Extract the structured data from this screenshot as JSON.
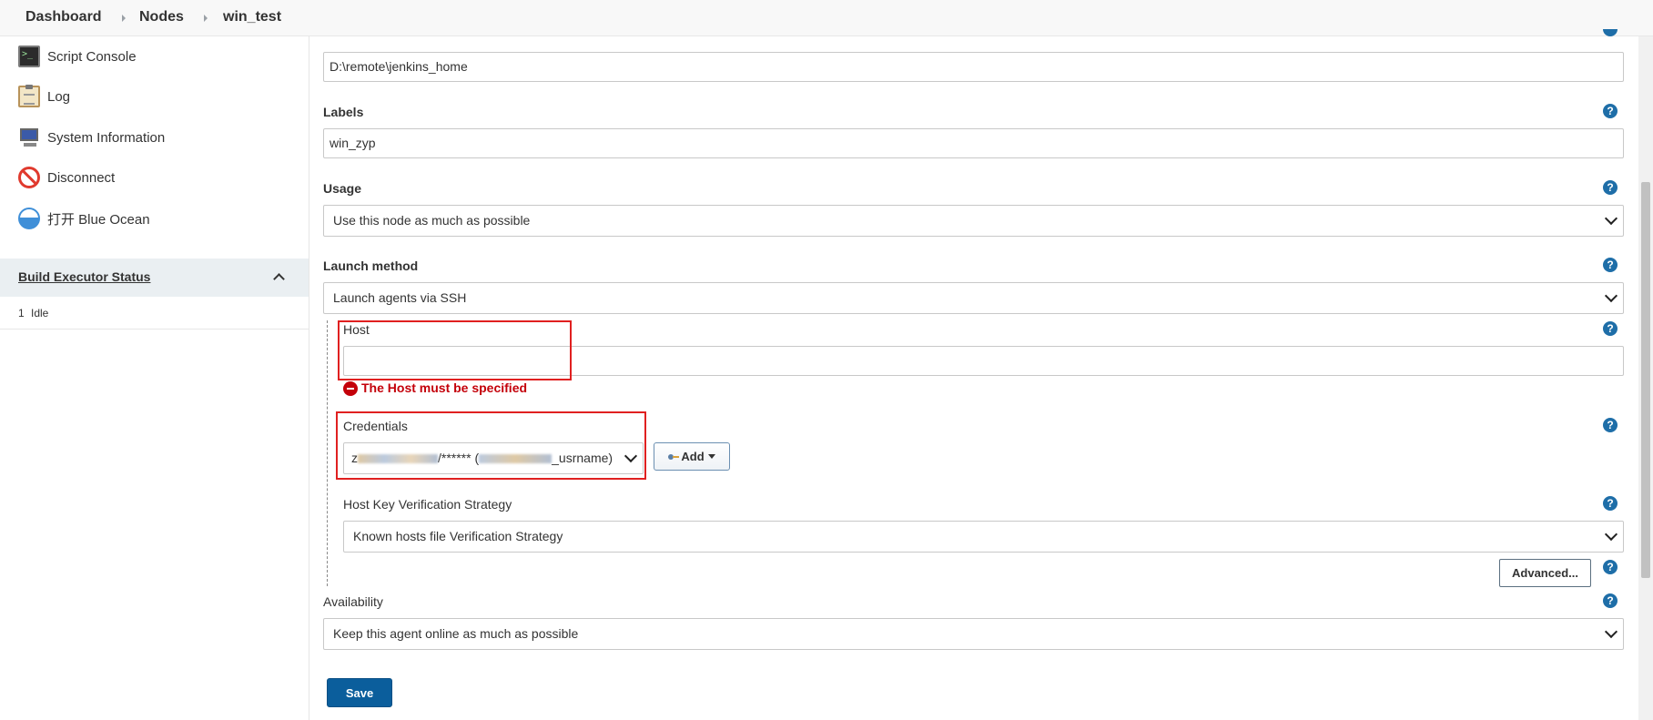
{
  "breadcrumb": {
    "items": [
      "Dashboard",
      "Nodes",
      "win_test"
    ]
  },
  "sidebar": {
    "tasks": [
      {
        "label": "Script Console",
        "icon": "terminal-icon"
      },
      {
        "label": "Log",
        "icon": "clipboard-icon"
      },
      {
        "label": "System Information",
        "icon": "computer-icon"
      },
      {
        "label": "Disconnect",
        "icon": "no-entry-icon"
      },
      {
        "label": "打开 Blue Ocean",
        "icon": "blue-ocean-icon"
      }
    ],
    "executor_status": {
      "title": "Build Executor Status",
      "rows": [
        {
          "number": "1",
          "state": "Idle"
        }
      ]
    }
  },
  "form": {
    "remote_root": {
      "value": "D:\\remote\\jenkins_home"
    },
    "labels": {
      "label": "Labels",
      "value": "win_zyp"
    },
    "usage": {
      "label": "Usage",
      "selected": "Use this node as much as possible"
    },
    "launch_method": {
      "label": "Launch method",
      "selected": "Launch agents via SSH"
    },
    "host": {
      "label": "Host",
      "value": "",
      "error": "The Host must be specified"
    },
    "credentials": {
      "label": "Credentials",
      "selected": "zhangdongyun/****** (zhangdongyun_usrname)",
      "selected_visible_start": "z",
      "selected_visible_middle": "/****** (",
      "selected_visible_end": "_usrname)",
      "add_label": "Add"
    },
    "host_key_strategy": {
      "label": "Host Key Verification Strategy",
      "selected": "Known hosts file Verification Strategy"
    },
    "advanced_label": "Advanced...",
    "availability": {
      "label": "Availability",
      "selected": "Keep this agent online as much as possible"
    },
    "save_label": "Save"
  },
  "colors": {
    "error": "#c4000a",
    "save_button": "#0b5e9c",
    "help_icon": "#1e6ea8",
    "highlight_box": "#e02020"
  }
}
